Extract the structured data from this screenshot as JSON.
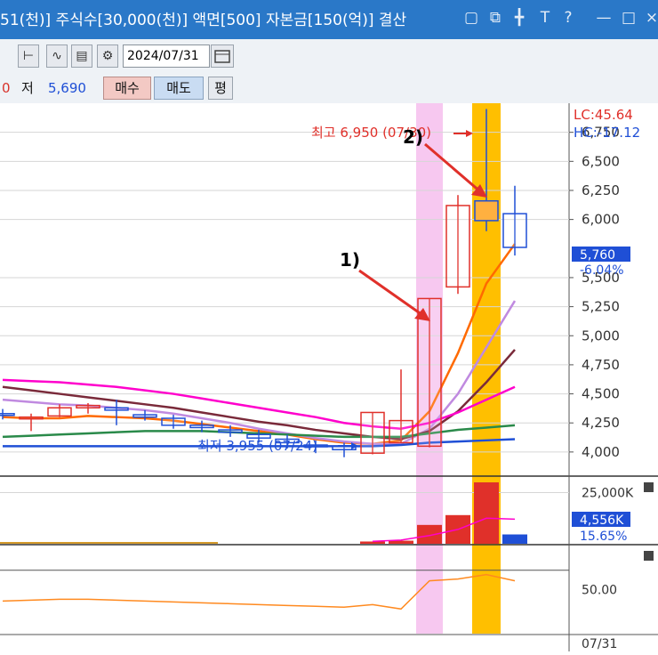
{
  "window": {
    "title": "51(천)] 주식수[30,000(천)] 액면[500] 자본금[150(억)] 결산",
    "icons": [
      "copy-icon",
      "restore-icon",
      "pin-icon",
      "text-icon",
      "help-icon",
      "minimize-icon",
      "maximize-icon"
    ],
    "help_glyph": "?",
    "text_glyph": "T"
  },
  "toolbar": {
    "date_value": "2024/07/31",
    "low_partial": "0",
    "low_label": "저",
    "low_value": "5,690",
    "buy_label": "매수",
    "sell_label": "매도",
    "eval_label": "평"
  },
  "chart_data": {
    "type": "candlestick",
    "price_axis_ticks": [
      "6,750",
      "6,500",
      "6,250",
      "6,000",
      "5,500",
      "5,250",
      "5,000",
      "4,750",
      "4,500",
      "4,250",
      "4,000"
    ],
    "ylim": [
      3800,
      7000
    ],
    "lc_label": "LC:45.64",
    "hc_label": "HC:-17.12",
    "high_annotation": "최고 6,950 (07/30)",
    "low_annotation": "최저 3,955 (07/24)",
    "current_price": "5,760",
    "current_change": "-6.04%",
    "callouts": [
      "1)",
      "2)"
    ],
    "candles": [
      {
        "o": 4330,
        "h": 4370,
        "l": 4280,
        "c": 4320
      },
      {
        "o": 4290,
        "h": 4330,
        "l": 4180,
        "c": 4300
      },
      {
        "o": 4310,
        "h": 4410,
        "l": 4300,
        "c": 4380
      },
      {
        "o": 4380,
        "h": 4420,
        "l": 4330,
        "c": 4400
      },
      {
        "o": 4380,
        "h": 4450,
        "l": 4230,
        "c": 4360
      },
      {
        "o": 4320,
        "h": 4360,
        "l": 4270,
        "c": 4300
      },
      {
        "o": 4290,
        "h": 4320,
        "l": 4200,
        "c": 4230
      },
      {
        "o": 4230,
        "h": 4270,
        "l": 4170,
        "c": 4210
      },
      {
        "o": 4190,
        "h": 4230,
        "l": 4130,
        "c": 4170
      },
      {
        "o": 4150,
        "h": 4190,
        "l": 4080,
        "c": 4120
      },
      {
        "o": 4110,
        "h": 4150,
        "l": 4030,
        "c": 4080
      },
      {
        "o": 4060,
        "h": 4100,
        "l": 3990,
        "c": 4050
      },
      {
        "o": 4050,
        "h": 4080,
        "l": 3955,
        "c": 4020
      },
      {
        "o": 3990,
        "h": 4340,
        "l": 3980,
        "c": 4340
      },
      {
        "o": 4080,
        "h": 4710,
        "l": 4080,
        "c": 4270
      },
      {
        "o": 4050,
        "h": 5320,
        "l": 4040,
        "c": 5320
      },
      {
        "o": 5420,
        "h": 6210,
        "l": 5360,
        "c": 6120
      },
      {
        "o": 6160,
        "h": 6950,
        "l": 5900,
        "c": 5990
      },
      {
        "o": 6050,
        "h": 6290,
        "l": 5690,
        "c": 5760
      }
    ],
    "moving_averages": [
      {
        "color": "#ff6a00",
        "values": [
          4300,
          4290,
          4290,
          4310,
          4300,
          4290,
          4270,
          4240,
          4210,
          4180,
          4150,
          4110,
          4080,
          4070,
          4100,
          4350,
          4850,
          5450,
          5790
        ]
      },
      {
        "color": "#c08ae0",
        "values": [
          4450,
          4430,
          4410,
          4400,
          4380,
          4360,
          4330,
          4290,
          4250,
          4200,
          4160,
          4120,
          4090,
          4070,
          4070,
          4200,
          4500,
          4900,
          5300
        ]
      },
      {
        "color": "#7a2a3a",
        "values": [
          4560,
          4530,
          4500,
          4470,
          4440,
          4410,
          4380,
          4340,
          4300,
          4260,
          4230,
          4190,
          4160,
          4130,
          4110,
          4180,
          4350,
          4600,
          4880
        ]
      },
      {
        "color": "#ff00cc",
        "values": [
          4620,
          4610,
          4600,
          4580,
          4560,
          4530,
          4500,
          4460,
          4420,
          4380,
          4340,
          4300,
          4250,
          4220,
          4200,
          4250,
          4340,
          4450,
          4560
        ]
      },
      {
        "color": "#2a8a4a",
        "values": [
          4130,
          4140,
          4150,
          4160,
          4170,
          4180,
          4180,
          4180,
          4170,
          4160,
          4150,
          4140,
          4130,
          4130,
          4130,
          4160,
          4190,
          4210,
          4230
        ]
      },
      {
        "color": "#1f4fd6",
        "values": [
          4050,
          4050,
          4050,
          4050,
          4050,
          4050,
          4050,
          4050,
          4050,
          4050,
          4050,
          4050,
          4050,
          4050,
          4060,
          4080,
          4090,
          4100,
          4110
        ]
      }
    ],
    "volume": {
      "ticks": [
        "25,000K"
      ],
      "current": "4,556K",
      "ratio": "15.65%",
      "ylim": [
        0,
        30000
      ],
      "bars": [
        1000,
        1000,
        1000,
        1000,
        1000,
        1000,
        1000,
        1000,
        1000,
        1000,
        1000,
        1000,
        1000,
        1100,
        1500,
        9200,
        14000,
        30000,
        4556
      ]
    },
    "indicator": {
      "tick": "50.00",
      "ylim": [
        0,
        100
      ],
      "values": [
        37,
        38,
        39,
        39,
        38,
        37,
        36,
        35,
        34,
        33,
        32,
        31,
        30,
        33,
        28,
        60,
        62,
        67,
        60
      ]
    },
    "x_date_label": "07/31"
  }
}
